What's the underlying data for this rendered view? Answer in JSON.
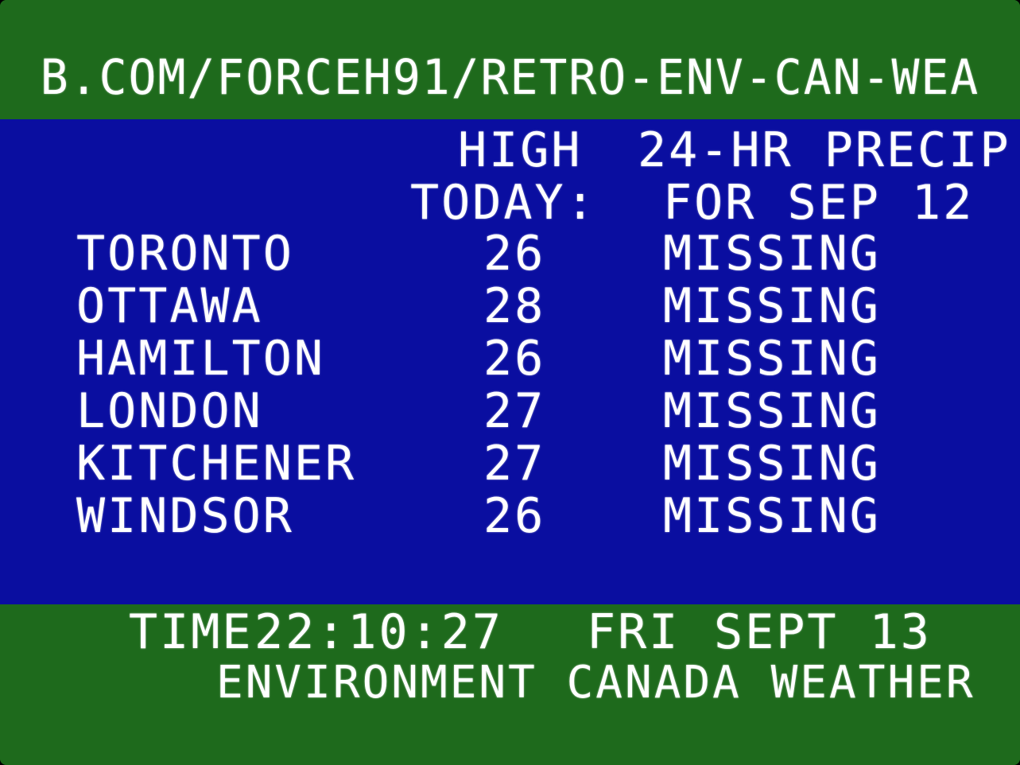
{
  "header": {
    "url_text": "B.COM/FORCEH91/RETRO-ENV-CAN-WEA"
  },
  "table": {
    "col_high_line1": "HIGH",
    "col_high_line2": "TODAY:",
    "col_precip_line1": "24-HR PRECIP",
    "col_precip_line2": "FOR SEP 12",
    "rows": [
      {
        "city": "TORONTO",
        "high": "26",
        "precip": "MISSING"
      },
      {
        "city": "OTTAWA",
        "high": "28",
        "precip": "MISSING"
      },
      {
        "city": "HAMILTON",
        "high": "26",
        "precip": "MISSING"
      },
      {
        "city": "LONDON",
        "high": "27",
        "precip": "MISSING"
      },
      {
        "city": "KITCHENER",
        "high": "27",
        "precip": "MISSING"
      },
      {
        "city": "WINDSOR",
        "high": "26",
        "precip": "MISSING"
      }
    ]
  },
  "footer": {
    "time_label": "TIME",
    "time_value": "22:10:27",
    "day": "FRI",
    "date": "SEPT 13",
    "station": "ENVIRONMENT CANADA WEATHER"
  },
  "colors": {
    "border_green": "#1e6a1c",
    "panel_blue": "#0a0ea0",
    "text": "#ffffff"
  }
}
